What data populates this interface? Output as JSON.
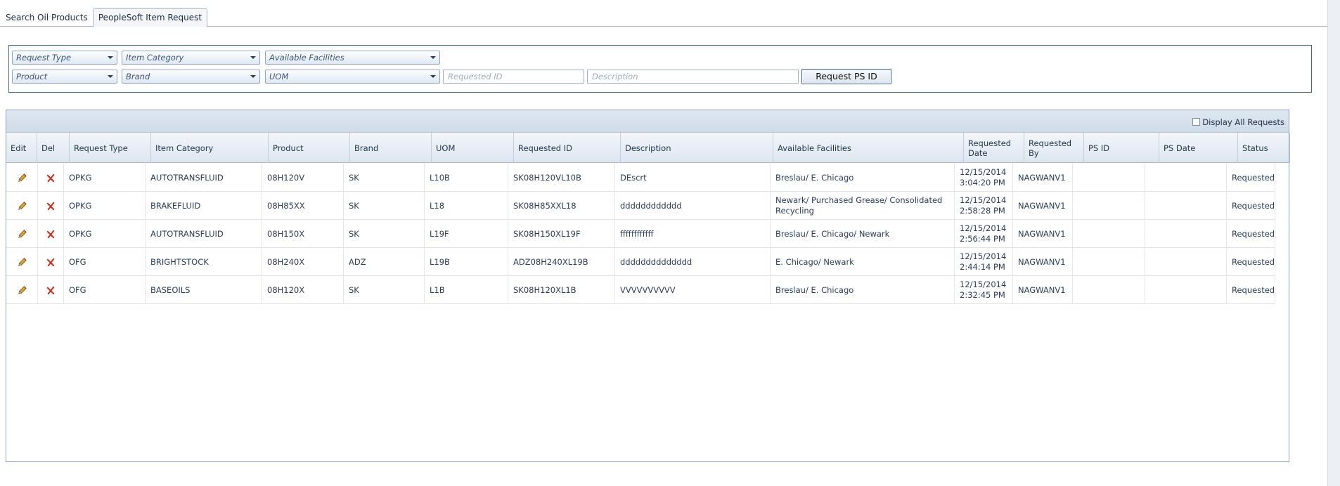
{
  "tabs": {
    "search_oil": "Search Oil Products",
    "peoplesoft": "PeopleSoft Item Request"
  },
  "filters": {
    "request_type": "Request Type",
    "item_category": "Item Category",
    "available_facilities": "Available Facilities",
    "product": "Product",
    "brand": "Brand",
    "uom": "UOM",
    "requested_id_placeholder": "Requested ID",
    "description_placeholder": "Description",
    "request_button": "Request PS ID"
  },
  "grid": {
    "display_all": "Display All Requests",
    "columns": [
      "Edit",
      "Del",
      "Request Type",
      "Item Category",
      "Product",
      "Brand",
      "UOM",
      "Requested ID",
      "Description",
      "Available Facilities",
      "Requested Date",
      "Requested By",
      "PS ID",
      "PS Date",
      "Status"
    ],
    "rows": [
      {
        "request_type": "OPKG",
        "item_category": "AUTOTRANSFLUID",
        "product": "08H120V",
        "brand": "SK",
        "uom": "L10B",
        "requested_id": "SK08H120VL10B",
        "description": "DEscrt",
        "facilities": "Breslau/ E. Chicago",
        "date": "12/15/2014 3:04:20 PM",
        "by": "NAGWANV1",
        "ps_id": "",
        "ps_date": "",
        "status": "Requested"
      },
      {
        "request_type": "OPKG",
        "item_category": "BRAKEFLUID",
        "product": "08H85XX",
        "brand": "SK",
        "uom": "L18",
        "requested_id": "SK08H85XXL18",
        "description": "dddddddddddd",
        "facilities": "Newark/ Purchased Grease/ Consolidated Recycling",
        "date": "12/15/2014 2:58:28 PM",
        "by": "NAGWANV1",
        "ps_id": "",
        "ps_date": "",
        "status": "Requested"
      },
      {
        "request_type": "OPKG",
        "item_category": "AUTOTRANSFLUID",
        "product": "08H150X",
        "brand": "SK",
        "uom": "L19F",
        "requested_id": "SK08H150XL19F",
        "description": "ffffffffffff",
        "facilities": "Breslau/ E. Chicago/ Newark",
        "date": "12/15/2014 2:56:44 PM",
        "by": "NAGWANV1",
        "ps_id": "",
        "ps_date": "",
        "status": "Requested"
      },
      {
        "request_type": "OFG",
        "item_category": "BRIGHTSTOCK",
        "product": "08H240X",
        "brand": "ADZ",
        "uom": "L19B",
        "requested_id": "ADZ08H240XL19B",
        "description": "dddddddddddddd",
        "facilities": "E. Chicago/ Newark",
        "date": "12/15/2014 2:44:14 PM",
        "by": "NAGWANV1",
        "ps_id": "",
        "ps_date": "",
        "status": "Requested"
      },
      {
        "request_type": "OFG",
        "item_category": "BASEOILS",
        "product": "08H120X",
        "brand": "SK",
        "uom": "L1B",
        "requested_id": "SK08H120XL1B",
        "description": "VVVVVVVVVV",
        "facilities": "Breslau/ E. Chicago",
        "date": "12/15/2014 2:32:45 PM",
        "by": "NAGWANV1",
        "ps_id": "",
        "ps_date": "",
        "status": "Requested"
      }
    ]
  },
  "colors": {
    "accent": "#3f6c86",
    "edit_icon": "#e0a32a",
    "delete_icon": "#d42a1f"
  },
  "icons": {
    "edit": "pencil-icon",
    "delete": "delete-x-icon"
  }
}
